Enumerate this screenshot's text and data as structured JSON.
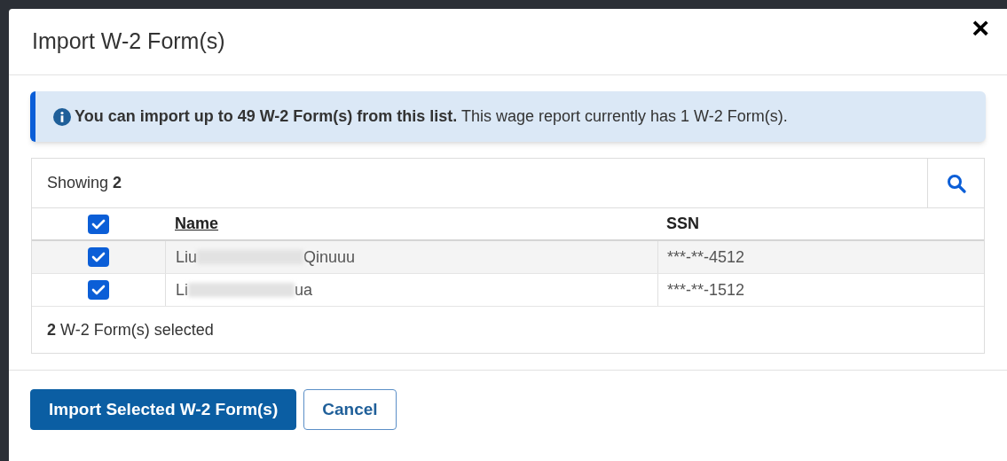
{
  "dialog": {
    "title": "Import W-2 Form(s)",
    "close": "×"
  },
  "alert": {
    "text": "**You can import up to 49 W-2 Form(s) from this list.** This wage report currently has 1 W-2 Form(s)."
  },
  "list": {
    "showing": "Showing **2**",
    "columns": [
      {
        "label": "Name"
      },
      {
        "label": "SSN"
      }
    ],
    "all_checked": true,
    "rows": [
      {
        "checked": true,
        "name_start": "Liu",
        "name_end": "Qinuuu",
        "ssn": "***-**-4512"
      },
      {
        "checked": true,
        "name_start": "Li",
        "name_end": "ua",
        "ssn": "***-**-1512"
      }
    ],
    "summary": "**2** W-2 Form(s) selected"
  },
  "buttons": [
    {
      "label": "Import Selected W-2 Form(s)",
      "kind": "primary"
    },
    {
      "label": "Cancel",
      "kind": "secondary"
    }
  ]
}
